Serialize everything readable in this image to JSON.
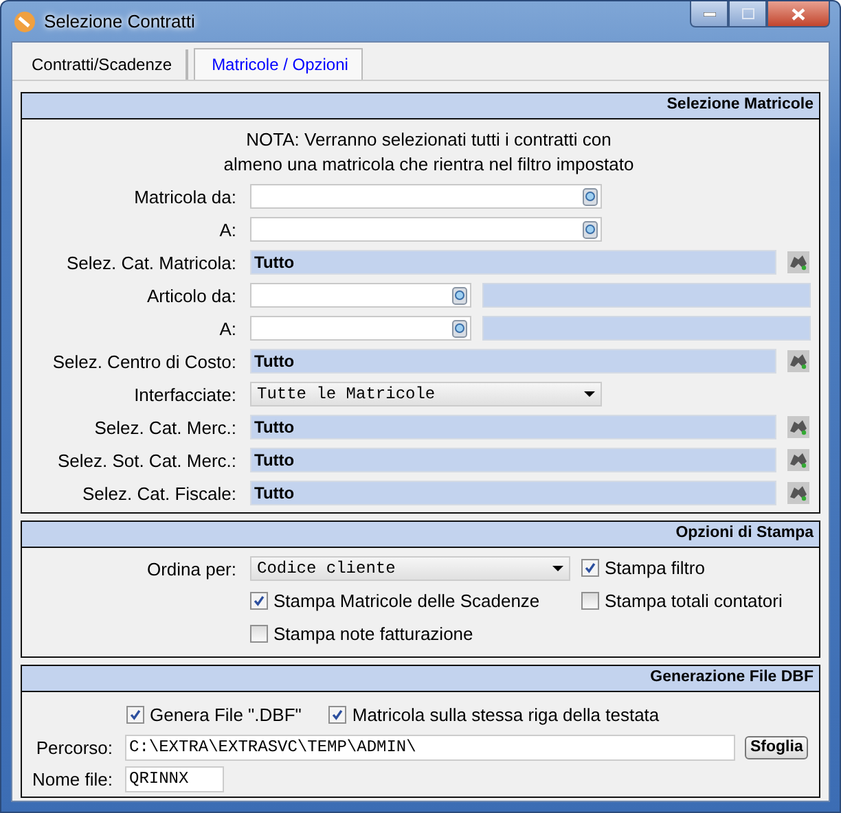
{
  "window": {
    "title": "Selezione Contratti"
  },
  "tabs": [
    {
      "label": "Contratti/Scadenze",
      "selected": false
    },
    {
      "label": "Matricole / Opzioni",
      "selected": true
    }
  ],
  "matricole": {
    "title": "Selezione Matricole",
    "note": "NOTA: Verranno selezionati tutti i contratti con\nalmeno una matricola che rientra nel filtro impostato",
    "rows": [
      {
        "kind": "lookup",
        "label": "Matricola da:"
      },
      {
        "kind": "lookup",
        "label": "A:"
      },
      {
        "kind": "category",
        "label": "Selez. Cat. Matricola:",
        "value": "Tutto"
      },
      {
        "kind": "range",
        "label": "Articolo da:"
      },
      {
        "kind": "range",
        "label": "A:"
      },
      {
        "kind": "category",
        "label": "Selez. Centro di Costo:",
        "value": "Tutto"
      },
      {
        "kind": "dropdown",
        "label": "Interfacciate:",
        "value": "Tutte le Matricole"
      },
      {
        "kind": "category",
        "label": "Selez. Cat. Merc.:",
        "value": "Tutto"
      },
      {
        "kind": "category",
        "label": "Selez. Sot. Cat. Merc.:",
        "value": "Tutto"
      },
      {
        "kind": "category",
        "label": "Selez. Cat. Fiscale:",
        "value": "Tutto"
      }
    ]
  },
  "print_options": {
    "title": "Opzioni di Stampa",
    "order_label": "Ordina per:",
    "order_value": "Codice cliente",
    "checks": [
      {
        "label": "Stampa filtro",
        "checked": true
      },
      {
        "label": "Stampa Matricole delle Scadenze",
        "checked": true
      },
      {
        "label": "Stampa totali contatori",
        "checked": false
      },
      {
        "label": "Stampa note fatturazione",
        "checked": false
      }
    ]
  },
  "dbf": {
    "title": "Generazione File DBF",
    "checks": [
      {
        "label": "Genera File \".DBF\"",
        "checked": true
      },
      {
        "label": "Matricola sulla stessa riga della testata",
        "checked": true
      }
    ],
    "path_label": "Percorso:",
    "path_value": "C:\\EXTRA\\EXTRASVC\\TEMP\\ADMIN\\",
    "browse_button": "Sfoglia",
    "name_label": "Nome file:",
    "name_value": "QRINNX"
  }
}
